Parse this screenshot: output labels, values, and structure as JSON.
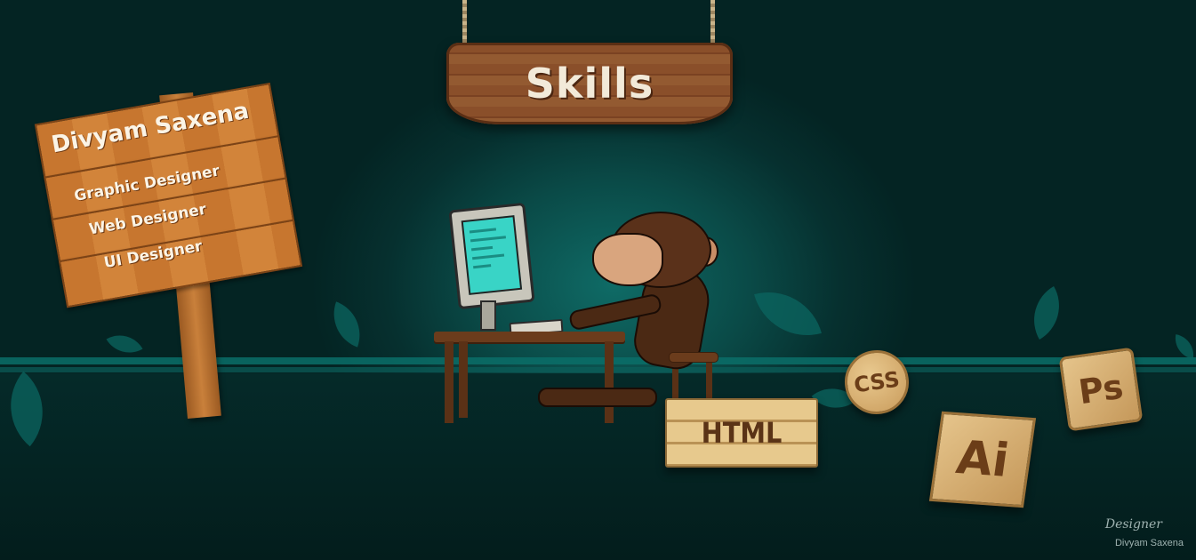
{
  "header": {
    "title": "Skills"
  },
  "signpost": {
    "name": "Divyam Saxena",
    "roles": [
      "Graphic Designer",
      "Web Designer",
      "UI Designer"
    ]
  },
  "skills": [
    {
      "icon": "html-badge",
      "label": "HTML"
    },
    {
      "icon": "css-badge",
      "label": "CSS"
    },
    {
      "icon": "ps-badge",
      "label": "Ps"
    },
    {
      "icon": "ai-badge",
      "label": "Ai"
    }
  ],
  "credit": {
    "role": "Designer",
    "name": "Divyam Saxena"
  },
  "colors": {
    "background": "#06302f",
    "accent": "#0b6e69",
    "wood": "#8a4f2a"
  }
}
